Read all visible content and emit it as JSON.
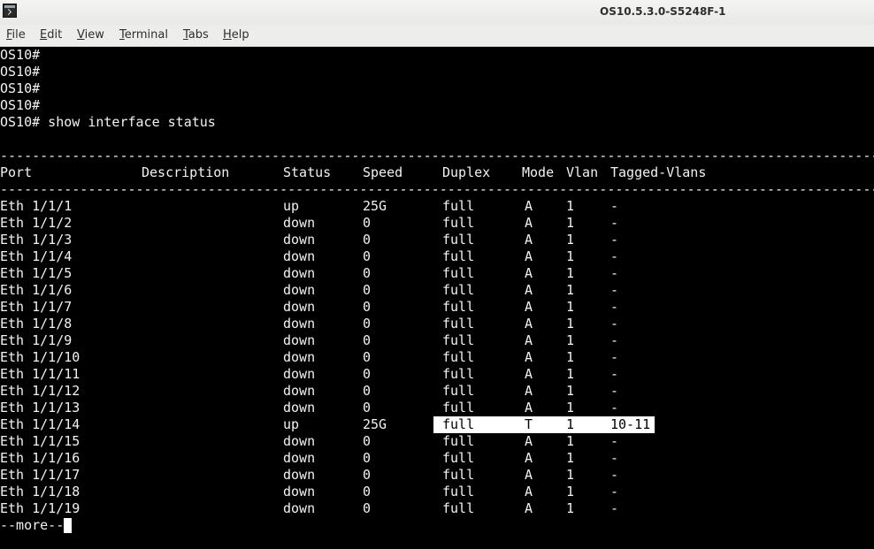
{
  "window": {
    "title": "OS10.5.3.0-S5248F-1"
  },
  "menu": [
    {
      "pre": "",
      "u": "F",
      "post": "ile"
    },
    {
      "pre": "",
      "u": "E",
      "post": "dit"
    },
    {
      "pre": "",
      "u": "V",
      "post": "iew"
    },
    {
      "pre": "",
      "u": "T",
      "post": "erminal"
    },
    {
      "pre": "",
      "u": "T",
      "post": "abs"
    },
    {
      "pre": "",
      "u": "H",
      "post": "elp"
    }
  ],
  "terminal": {
    "prompts": [
      "OS10#",
      "OS10#",
      "OS10#",
      "OS10#"
    ],
    "command": "OS10# show interface status",
    "separator": "---------------------------------------------------------------------------------------------------------------------",
    "headers": {
      "port": "Port",
      "description": "Description",
      "status": "Status",
      "speed": "Speed",
      "duplex": "Duplex",
      "mode": "Mode",
      "vlan": "Vlan",
      "tagged": "Tagged-Vlans"
    },
    "rows": [
      {
        "port": "Eth 1/1/1",
        "status": "up",
        "speed": "25G",
        "duplex": "full",
        "mode": "A",
        "vlan": "1",
        "tagged": "-"
      },
      {
        "port": "Eth 1/1/2",
        "status": "down",
        "speed": "0",
        "duplex": "full",
        "mode": "A",
        "vlan": "1",
        "tagged": "-"
      },
      {
        "port": "Eth 1/1/3",
        "status": "down",
        "speed": "0",
        "duplex": "full",
        "mode": "A",
        "vlan": "1",
        "tagged": "-"
      },
      {
        "port": "Eth 1/1/4",
        "status": "down",
        "speed": "0",
        "duplex": "full",
        "mode": "A",
        "vlan": "1",
        "tagged": "-"
      },
      {
        "port": "Eth 1/1/5",
        "status": "down",
        "speed": "0",
        "duplex": "full",
        "mode": "A",
        "vlan": "1",
        "tagged": "-"
      },
      {
        "port": "Eth 1/1/6",
        "status": "down",
        "speed": "0",
        "duplex": "full",
        "mode": "A",
        "vlan": "1",
        "tagged": "-"
      },
      {
        "port": "Eth 1/1/7",
        "status": "down",
        "speed": "0",
        "duplex": "full",
        "mode": "A",
        "vlan": "1",
        "tagged": "-"
      },
      {
        "port": "Eth 1/1/8",
        "status": "down",
        "speed": "0",
        "duplex": "full",
        "mode": "A",
        "vlan": "1",
        "tagged": "-"
      },
      {
        "port": "Eth 1/1/9",
        "status": "down",
        "speed": "0",
        "duplex": "full",
        "mode": "A",
        "vlan": "1",
        "tagged": "-"
      },
      {
        "port": "Eth 1/1/10",
        "status": "down",
        "speed": "0",
        "duplex": "full",
        "mode": "A",
        "vlan": "1",
        "tagged": "-"
      },
      {
        "port": "Eth 1/1/11",
        "status": "down",
        "speed": "0",
        "duplex": "full",
        "mode": "A",
        "vlan": "1",
        "tagged": "-"
      },
      {
        "port": "Eth 1/1/12",
        "status": "down",
        "speed": "0",
        "duplex": "full",
        "mode": "A",
        "vlan": "1",
        "tagged": "-"
      },
      {
        "port": "Eth 1/1/13",
        "status": "down",
        "speed": "0",
        "duplex": "full",
        "mode": "A",
        "vlan": "1",
        "tagged": "-"
      },
      {
        "port": "Eth 1/1/14",
        "status": "up",
        "speed": "25G",
        "duplex": "full",
        "mode": "T",
        "vlan": "1",
        "tagged": "10-11",
        "highlighted": true
      },
      {
        "port": "Eth 1/1/15",
        "status": "down",
        "speed": "0",
        "duplex": "full",
        "mode": "A",
        "vlan": "1",
        "tagged": "-"
      },
      {
        "port": "Eth 1/1/16",
        "status": "down",
        "speed": "0",
        "duplex": "full",
        "mode": "A",
        "vlan": "1",
        "tagged": "-"
      },
      {
        "port": "Eth 1/1/17",
        "status": "down",
        "speed": "0",
        "duplex": "full",
        "mode": "A",
        "vlan": "1",
        "tagged": "-"
      },
      {
        "port": "Eth 1/1/18",
        "status": "down",
        "speed": "0",
        "duplex": "full",
        "mode": "A",
        "vlan": "1",
        "tagged": "-"
      },
      {
        "port": "Eth 1/1/19",
        "status": "down",
        "speed": "0",
        "duplex": "full",
        "mode": "A",
        "vlan": "1",
        "tagged": "-"
      }
    ],
    "pager": "--more--"
  },
  "colors": {
    "terminal_bg": "#000000",
    "terminal_fg": "#ffffff",
    "highlight_bg": "#ffffff",
    "highlight_fg": "#000000"
  },
  "icons": {
    "app": "terminal-icon"
  }
}
